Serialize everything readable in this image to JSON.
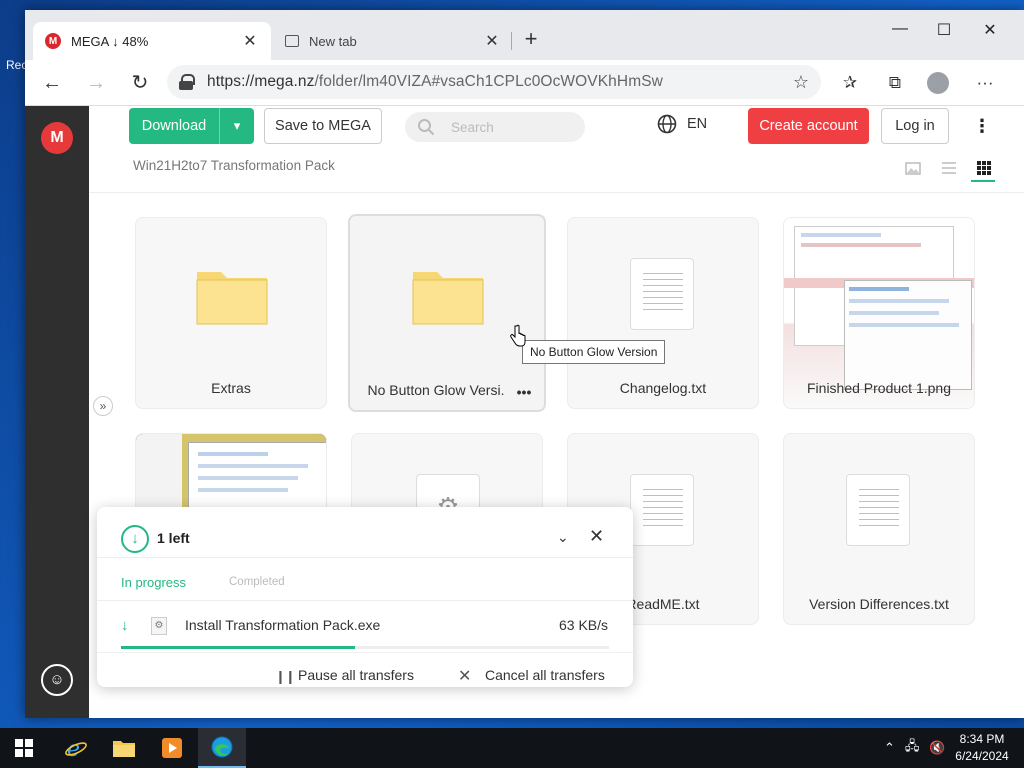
{
  "desktop": {
    "icon_label": "Recycle Bin"
  },
  "browser": {
    "tabs": [
      {
        "title": "MEGA ↓ 48%",
        "active": true
      },
      {
        "title": "New tab",
        "active": false
      }
    ],
    "url": "https://mega.nz/folder/lm40VIZA#vsaCh1CPLc0OcWOVKhHmSw",
    "url_host": "https://mega.nz",
    "url_path": "/folder/lm40VIZA#vsaCh1CPLc0OcWOVKhHmSw"
  },
  "mega": {
    "download_label": "Download",
    "save_label": "Save to MEGA",
    "search_placeholder": "Search",
    "language": "EN",
    "create_account_label": "Create account",
    "login_label": "Log in",
    "folder_name": "Win21H2to7 Transformation Pack",
    "items": [
      {
        "name": "Extras",
        "type": "folder"
      },
      {
        "name": "No Button Glow Versi.",
        "type": "folder"
      },
      {
        "name": "Changelog.txt",
        "type": "txt"
      },
      {
        "name": "Finished Product 1.png",
        "type": "image"
      },
      {
        "name": "",
        "type": "image"
      },
      {
        "name": "",
        "type": "exe"
      },
      {
        "name": "ReadME.txt",
        "type": "txt"
      },
      {
        "name": "Version Differences.txt",
        "type": "txt"
      }
    ],
    "tooltip": "No Button Glow Version"
  },
  "transfer": {
    "count_label": "1 left",
    "tab_in_progress": "In progress",
    "tab_completed": "Completed",
    "file_name": "Install Transformation Pack.exe",
    "speed": "63 KB/s",
    "progress": 0.48,
    "pause_all": "Pause all transfers",
    "cancel_all": "Cancel all transfers"
  },
  "taskbar": {
    "time": "8:34 PM",
    "date": "6/24/2024"
  },
  "colors": {
    "mega_green": "#24b882",
    "mega_red": "#f03f43",
    "sidebar": "#2f2f2f"
  }
}
